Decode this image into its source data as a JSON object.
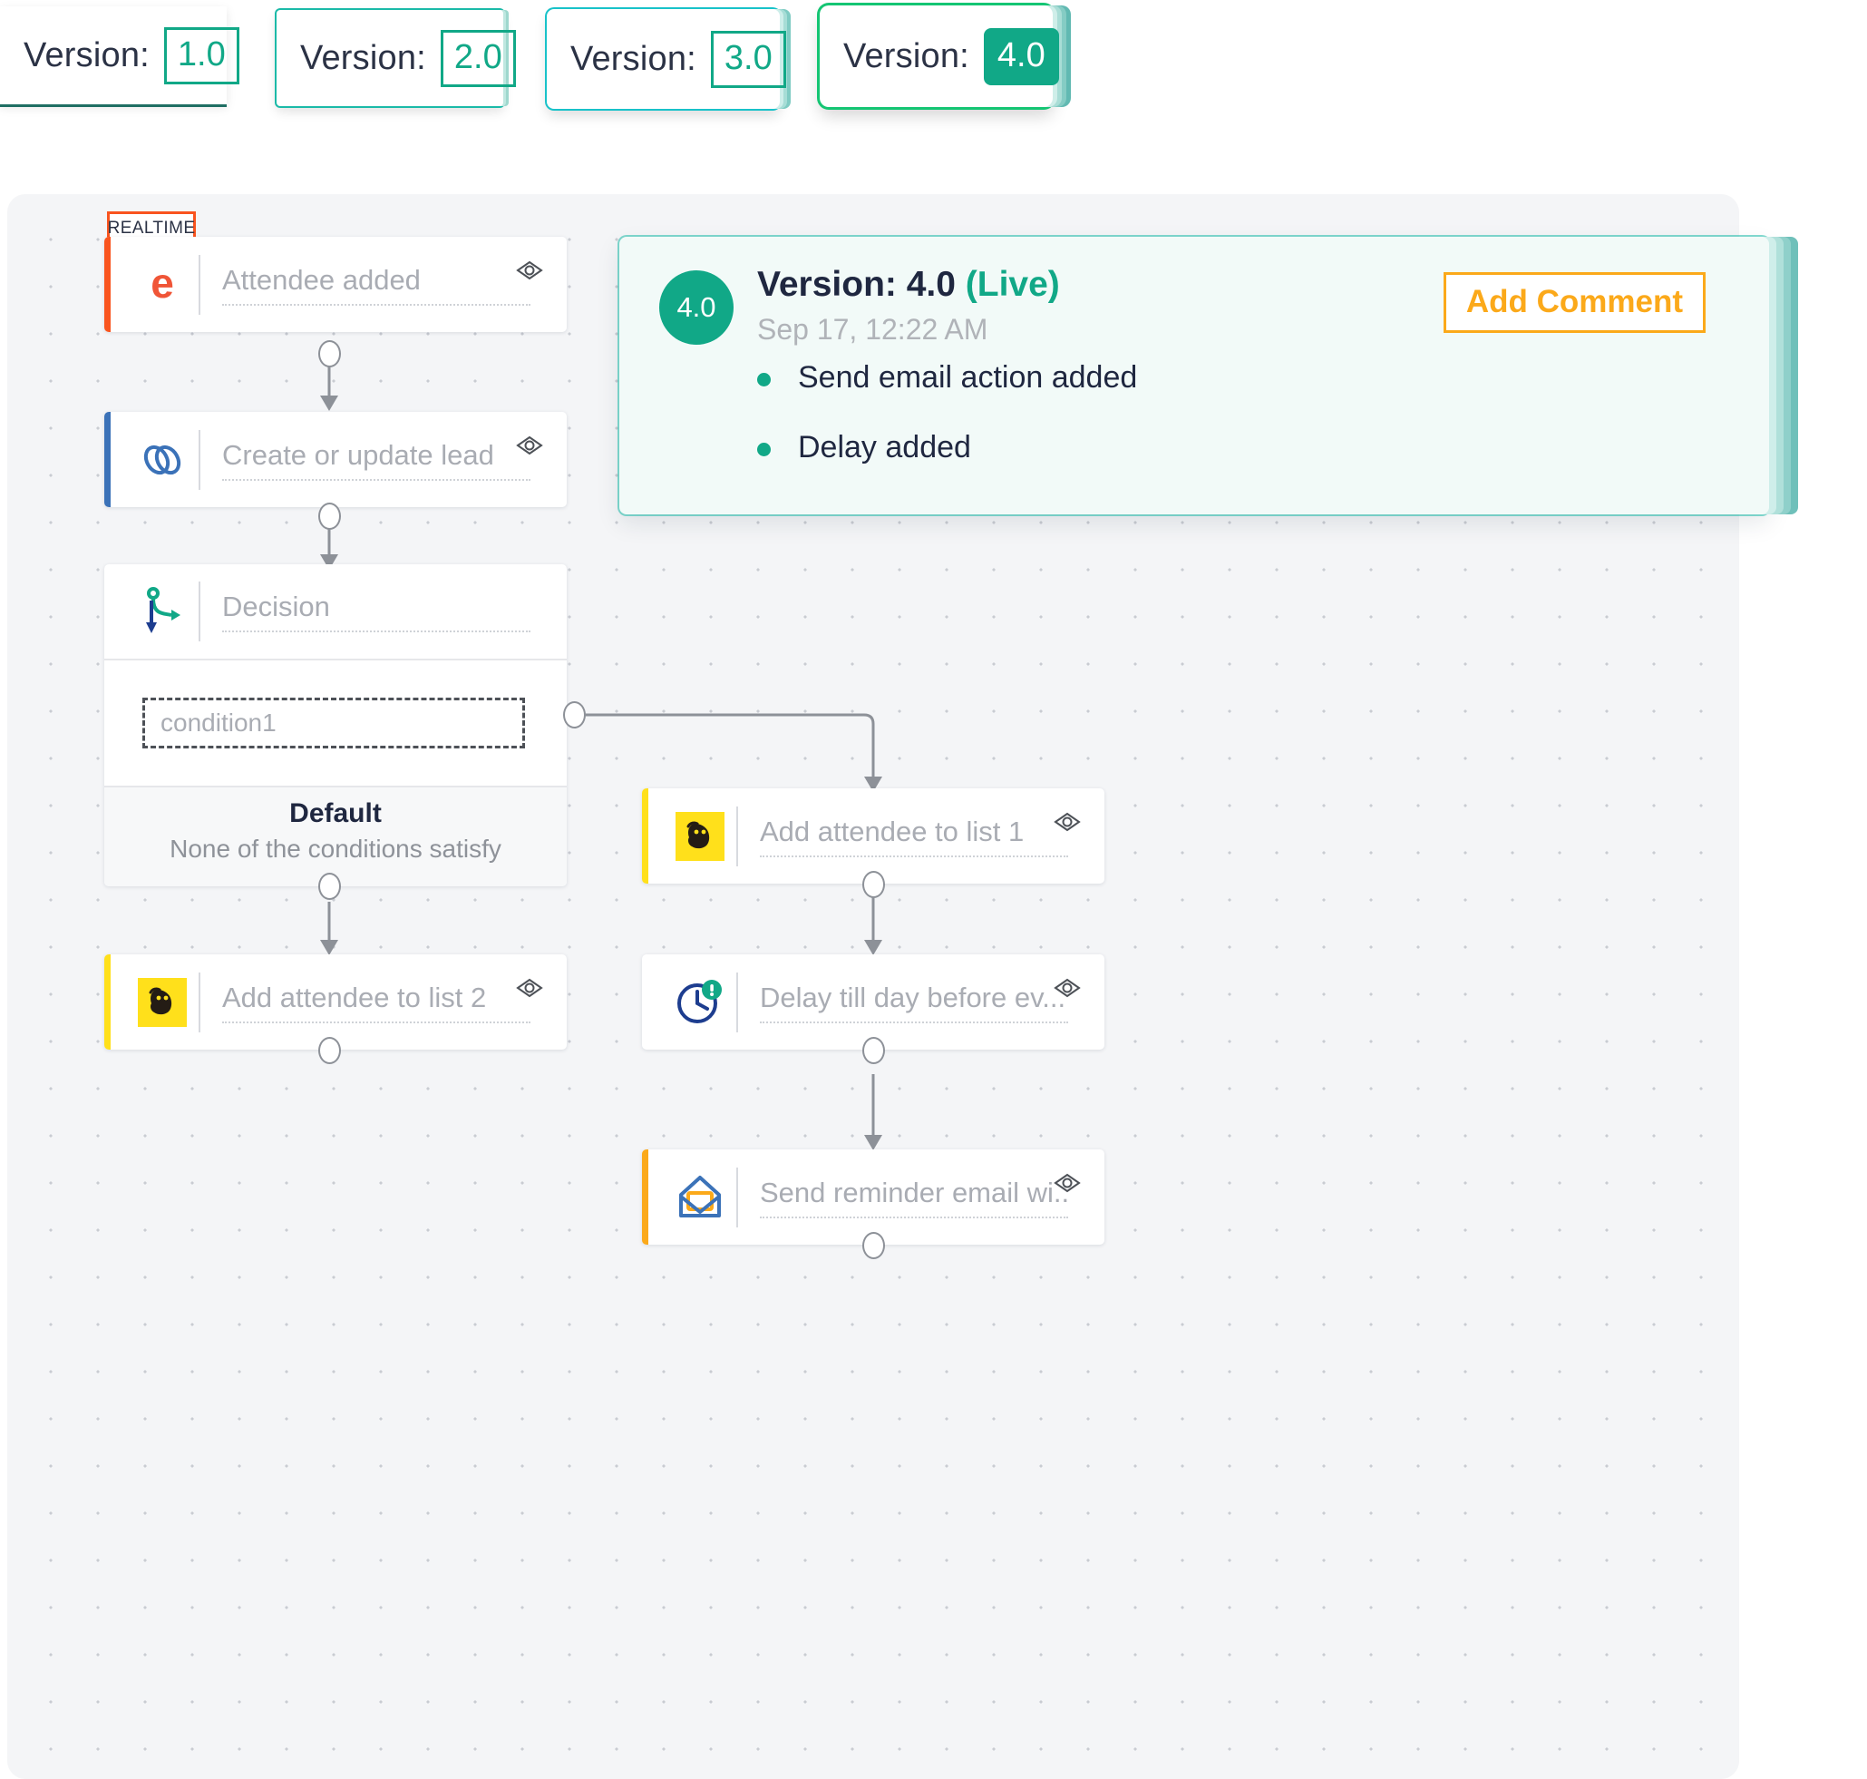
{
  "version_strip": {
    "cards": [
      {
        "label": "Version:",
        "value": "1.0",
        "state": "outline"
      },
      {
        "label": "Version:",
        "value": "2.0",
        "state": "outline"
      },
      {
        "label": "Version:",
        "value": "3.0",
        "state": "outline"
      },
      {
        "label": "Version:",
        "value": "4.0",
        "state": "filled"
      }
    ]
  },
  "canvas": {
    "realtime_badge": "REALTIME",
    "nodes": {
      "attendee_added": {
        "title": "Attendee added",
        "icon": "eventbrite-e-icon",
        "accent": "#f9541e"
      },
      "create_update_lead": {
        "title": "Create or update lead",
        "icon": "zoho-links-icon",
        "accent": "#3b72b8"
      },
      "decision": {
        "title": "Decision",
        "icon": "decision-branch-icon",
        "condition": "condition1",
        "default_title": "Default",
        "default_subtitle": "None of the conditions satisfy"
      },
      "add_list_2": {
        "title": "Add attendee to list 2",
        "icon": "mailchimp-icon",
        "accent": "#ffe01b"
      },
      "add_list_1": {
        "title": "Add attendee to list 1",
        "icon": "mailchimp-icon",
        "accent": "#ffe01b"
      },
      "delay": {
        "title": "Delay till day before ev...",
        "icon": "clock-alert-icon",
        "accent": "#ffffff"
      },
      "send_reminder": {
        "title": "Send reminder email wi...",
        "icon": "open-envelope-icon",
        "accent": "#fba91a"
      }
    }
  },
  "comment_panel": {
    "avatar": "4.0",
    "title_prefix": "Version: 4.0",
    "title_live": "(Live)",
    "timestamp": "Sep 17, 12:22 AM",
    "bullets": [
      "Send email action added",
      "Delay added"
    ],
    "add_comment_label": "Add Comment"
  },
  "colors": {
    "teal": "#11a887",
    "orange": "#fba91a",
    "red": "#f9541e",
    "blue": "#3b72b8",
    "yellow": "#ffe01b",
    "canvas_bg": "#f4f5f7",
    "panel_bg": "#f2faf8"
  }
}
